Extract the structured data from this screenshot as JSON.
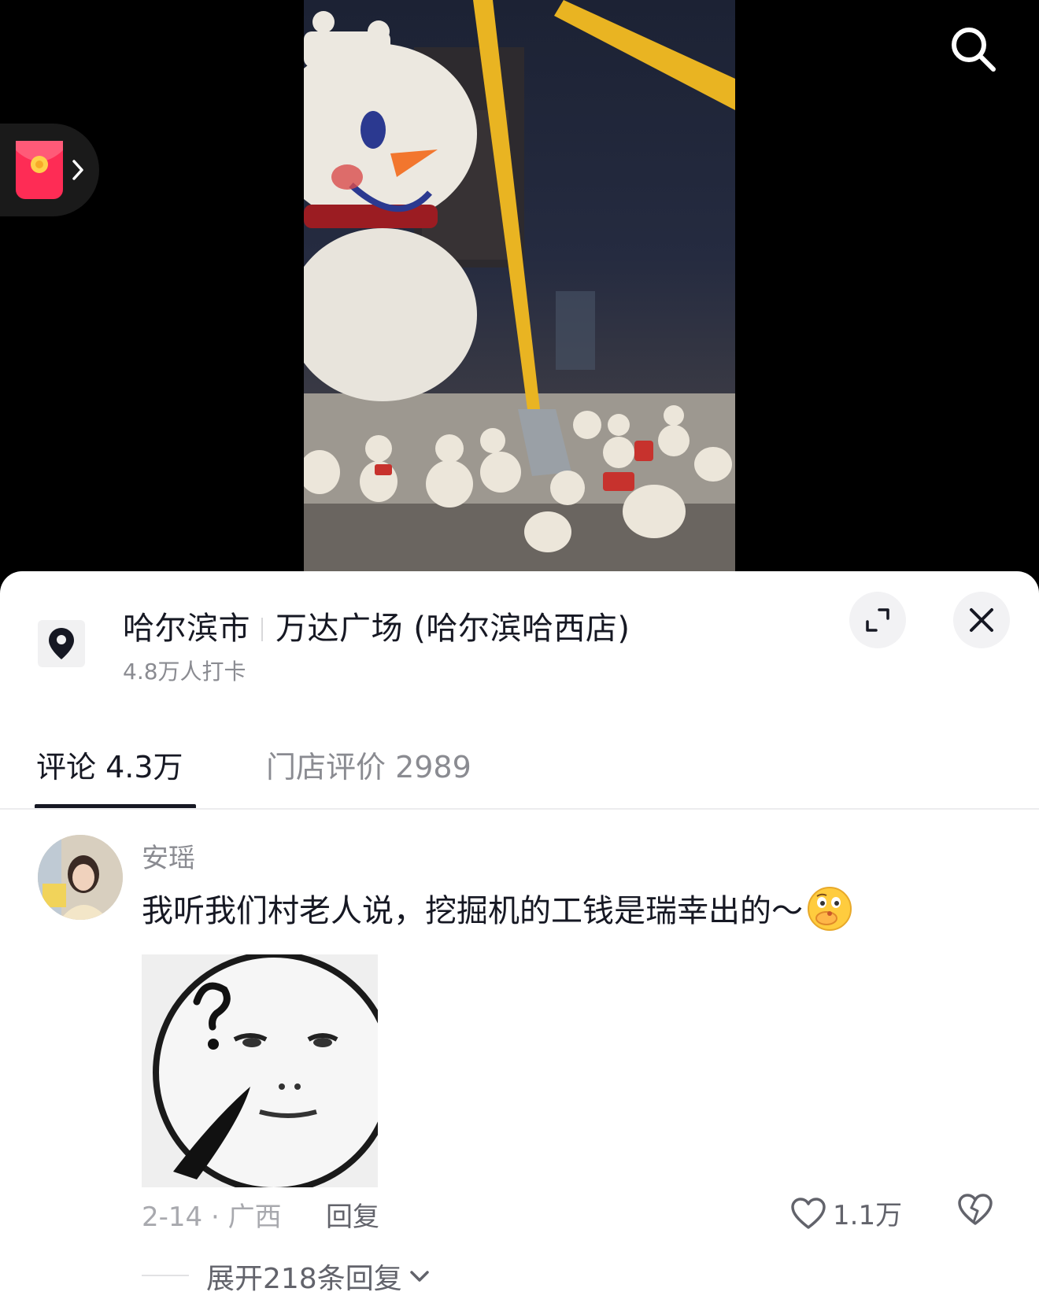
{
  "video": {
    "description_icon": "snowman-excavator-scene"
  },
  "top_bar": {
    "search_icon": "search-icon",
    "red_packet_icon": "red-packet-icon"
  },
  "poi": {
    "city": "哈尔滨市",
    "place": "万达广场 (哈尔滨哈西店)",
    "checkins": "4.8万人打卡",
    "pin_icon": "location-pin-icon",
    "expand_icon": "expand-icon",
    "close_icon": "close-icon"
  },
  "tabs": [
    {
      "label": "评论 4.3万",
      "active": true
    },
    {
      "label": "门店评价 2989",
      "active": false
    }
  ],
  "comment": {
    "username": "安瑶",
    "text": "我听我们村老人说，挖掘机的工钱是瑞幸出的～",
    "emoji": "thinking-face-emoji",
    "date_location": "2-14 · 广西",
    "reply_label": "回复",
    "like_count": "1.1万",
    "expand_replies": "展开218条回复"
  },
  "colors": {
    "primary_text": "#161823",
    "secondary_text": "#8a8b91",
    "red_packet": "#fe2c55"
  }
}
